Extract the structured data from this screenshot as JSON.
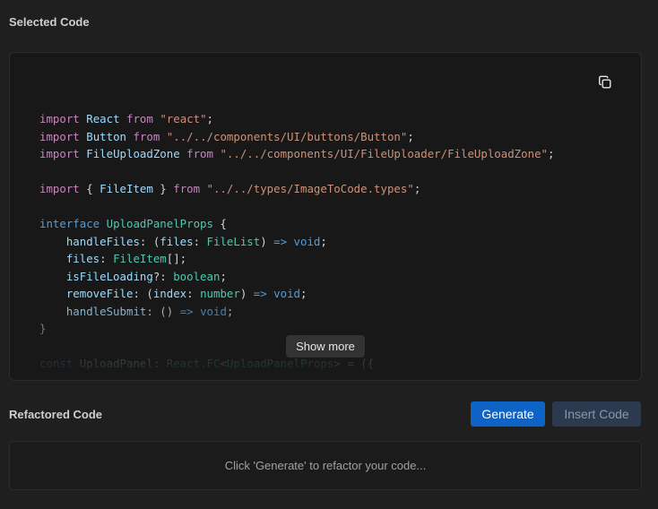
{
  "selected_section": {
    "title": "Selected Code"
  },
  "code_panel": {
    "copy_icon": "copy-icon",
    "lines": [
      [
        [
          "kw-purple",
          "import"
        ],
        [
          "punc",
          " "
        ],
        [
          "ident",
          "React"
        ],
        [
          "punc",
          " "
        ],
        [
          "kw-purple",
          "from"
        ],
        [
          "punc",
          " "
        ],
        [
          "str",
          "\"react\""
        ],
        [
          "punc",
          ";"
        ]
      ],
      [
        [
          "kw-purple",
          "import"
        ],
        [
          "punc",
          " "
        ],
        [
          "ident",
          "Button"
        ],
        [
          "punc",
          " "
        ],
        [
          "kw-purple",
          "from"
        ],
        [
          "punc",
          " "
        ],
        [
          "str",
          "\"../../components/UI/buttons/Button\""
        ],
        [
          "punc",
          ";"
        ]
      ],
      [
        [
          "kw-purple",
          "import"
        ],
        [
          "punc",
          " "
        ],
        [
          "ident",
          "FileUploadZone"
        ],
        [
          "punc",
          " "
        ],
        [
          "kw-purple",
          "from"
        ],
        [
          "punc",
          " "
        ],
        [
          "str",
          "\"../../components/UI/FileUploader/FileUploadZone\""
        ],
        [
          "punc",
          ";"
        ]
      ],
      [],
      [
        [
          "kw-purple",
          "import"
        ],
        [
          "punc",
          " { "
        ],
        [
          "ident",
          "FileItem"
        ],
        [
          "punc",
          " } "
        ],
        [
          "kw-purple",
          "from"
        ],
        [
          "punc",
          " "
        ],
        [
          "str",
          "\"../../types/ImageToCode.types\""
        ],
        [
          "punc",
          ";"
        ]
      ],
      [],
      [
        [
          "kw-blue",
          "interface"
        ],
        [
          "punc",
          " "
        ],
        [
          "type",
          "UploadPanelProps"
        ],
        [
          "punc",
          " {"
        ]
      ],
      [
        [
          "punc",
          "    "
        ],
        [
          "ident",
          "handleFiles"
        ],
        [
          "punc",
          ": ("
        ],
        [
          "ident",
          "files"
        ],
        [
          "punc",
          ": "
        ],
        [
          "type",
          "FileList"
        ],
        [
          "punc",
          ") "
        ],
        [
          "kw-blue",
          "=>"
        ],
        [
          "punc",
          " "
        ],
        [
          "kw-blue",
          "void"
        ],
        [
          "punc",
          ";"
        ]
      ],
      [
        [
          "punc",
          "    "
        ],
        [
          "ident",
          "files"
        ],
        [
          "punc",
          ": "
        ],
        [
          "type",
          "FileItem"
        ],
        [
          "punc",
          "[];"
        ]
      ],
      [
        [
          "punc",
          "    "
        ],
        [
          "ident",
          "isFileLoading"
        ],
        [
          "punc",
          "?: "
        ],
        [
          "type",
          "boolean"
        ],
        [
          "punc",
          ";"
        ]
      ],
      [
        [
          "punc",
          "    "
        ],
        [
          "ident",
          "removeFile"
        ],
        [
          "punc",
          ": ("
        ],
        [
          "ident",
          "index"
        ],
        [
          "punc",
          ": "
        ],
        [
          "type",
          "number"
        ],
        [
          "punc",
          ") "
        ],
        [
          "kw-blue",
          "=>"
        ],
        [
          "punc",
          " "
        ],
        [
          "kw-blue",
          "void"
        ],
        [
          "punc",
          ";"
        ]
      ],
      [
        [
          "punc",
          "    "
        ],
        [
          "ident",
          "handleSubmit"
        ],
        [
          "punc",
          ": () "
        ],
        [
          "kw-blue",
          "=>"
        ],
        [
          "punc",
          " "
        ],
        [
          "kw-blue",
          "void"
        ],
        [
          "punc",
          ";"
        ]
      ],
      [
        [
          "punc",
          "}"
        ]
      ],
      [],
      [
        [
          "kw-blue",
          "const"
        ],
        [
          "punc",
          " "
        ],
        [
          "ident",
          "UploadPanel"
        ],
        [
          "punc",
          ": "
        ],
        [
          "type",
          "React.FC"
        ],
        [
          "punc",
          "<"
        ],
        [
          "type",
          "UploadPanelProps"
        ],
        [
          "punc",
          "> = ({"
        ]
      ]
    ],
    "show_more_label": "Show more"
  },
  "refactored_section": {
    "title": "Refactored Code",
    "generate_label": "Generate",
    "insert_label": "Insert Code",
    "placeholder": "Click 'Generate' to refactor your code..."
  },
  "colors": {
    "background": "#1f1f1f",
    "panel": "#181818",
    "primary_button": "#0e63c7",
    "disabled_button": "#2b3a4f"
  }
}
